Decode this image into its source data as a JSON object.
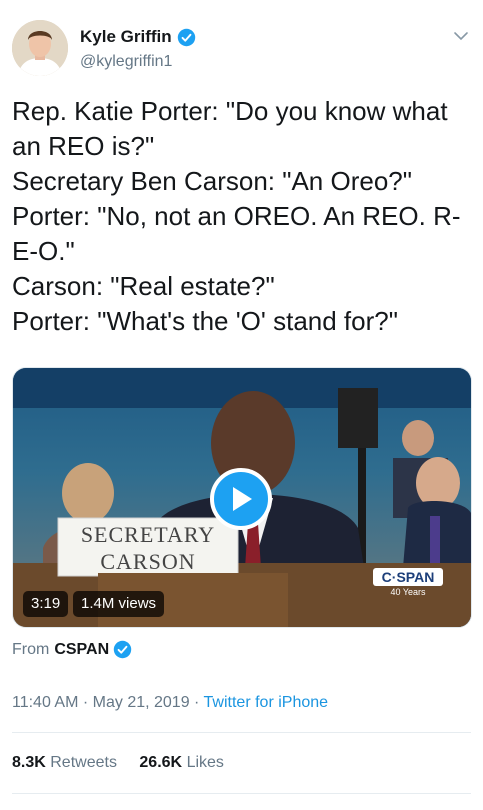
{
  "user": {
    "name": "Kyle Griffin",
    "handle": "@kylegriffin1"
  },
  "tweet": {
    "lines": [
      "Rep. Katie Porter: \"Do you know what an REO is?\"",
      "Secretary Ben Carson: \"An Oreo?\"",
      "Porter: \"No, not an OREO. An REO. R-E-O.\"",
      "Carson: \"Real estate?\"",
      "Porter: \"What's the 'O' stand for?\""
    ]
  },
  "video": {
    "duration": "3:19",
    "views": "1.4M views",
    "nameplate_line1": "SECRETARY",
    "nameplate_line2": "CARSON",
    "network_logo": "C·SPAN",
    "network_sub": "40 Years"
  },
  "source": {
    "prefix": "From",
    "name": "CSPAN"
  },
  "meta": {
    "time": "11:40 AM",
    "sep1": " · ",
    "date": "May 21, 2019",
    "sep2": " · ",
    "app": "Twitter for iPhone"
  },
  "stats": {
    "retweets_count": "8.3K",
    "retweets_label": "Retweets",
    "likes_count": "26.6K",
    "likes_label": "Likes"
  },
  "colors": {
    "accent": "#1da1f2",
    "secondary_text": "#657786"
  }
}
